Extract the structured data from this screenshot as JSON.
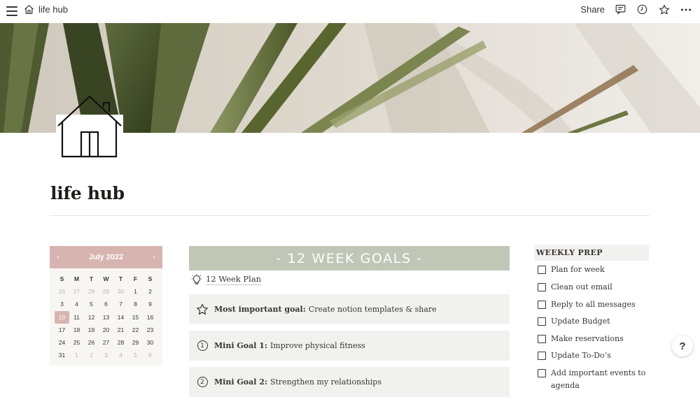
{
  "topbar": {
    "breadcrumb_title": "life hub",
    "share_label": "Share",
    "icons": [
      "menu-icon",
      "home-icon",
      "comment-icon",
      "clock-icon",
      "star-icon",
      "more-icon"
    ]
  },
  "page": {
    "title": "life hub",
    "icon": "house-icon"
  },
  "calendar": {
    "month_label": "July 2022",
    "prev": "‹",
    "next": "›",
    "weekdays": [
      "S",
      "M",
      "T",
      "W",
      "T",
      "F",
      "S"
    ],
    "days": [
      {
        "d": "26",
        "m": true
      },
      {
        "d": "27",
        "m": true
      },
      {
        "d": "28",
        "m": true
      },
      {
        "d": "29",
        "m": true
      },
      {
        "d": "30",
        "m": true
      },
      {
        "d": "1"
      },
      {
        "d": "2"
      },
      {
        "d": "3"
      },
      {
        "d": "4"
      },
      {
        "d": "5"
      },
      {
        "d": "6"
      },
      {
        "d": "7"
      },
      {
        "d": "8"
      },
      {
        "d": "9"
      },
      {
        "d": "10",
        "today": true
      },
      {
        "d": "11"
      },
      {
        "d": "12"
      },
      {
        "d": "13"
      },
      {
        "d": "14"
      },
      {
        "d": "15"
      },
      {
        "d": "16"
      },
      {
        "d": "17"
      },
      {
        "d": "18"
      },
      {
        "d": "19"
      },
      {
        "d": "20"
      },
      {
        "d": "21"
      },
      {
        "d": "22"
      },
      {
        "d": "23"
      },
      {
        "d": "24"
      },
      {
        "d": "25"
      },
      {
        "d": "26"
      },
      {
        "d": "27"
      },
      {
        "d": "28"
      },
      {
        "d": "29"
      },
      {
        "d": "30"
      },
      {
        "d": "31"
      },
      {
        "d": "1",
        "m": true
      },
      {
        "d": "2",
        "m": true
      },
      {
        "d": "3",
        "m": true
      },
      {
        "d": "4",
        "m": true
      },
      {
        "d": "5",
        "m": true
      },
      {
        "d": "6",
        "m": true
      }
    ],
    "header_color": "#d8b4b0"
  },
  "goals": {
    "banner": "- 12 WEEK GOALS -",
    "banner_color": "#c0c7b7",
    "plan_link": "12 Week Plan",
    "items": [
      {
        "bold": "Most important goal:",
        "text": "Create notion templates & share",
        "icon": "star-icon"
      },
      {
        "bold": "Mini Goal 1:",
        "text": "Improve physical fitness",
        "num": "1"
      },
      {
        "bold": "Mini Goal 2:",
        "text": "Strengthen my relationships",
        "num": "2"
      }
    ]
  },
  "weekly_prep": {
    "heading": "WEEKLY PREP",
    "todos": [
      "Plan for week",
      "Clean out email",
      "Reply to all messages",
      "Update Budget",
      "Make reservations",
      "Update To-Do’s",
      "Add important events to agenda"
    ]
  },
  "help": {
    "label": "?"
  }
}
